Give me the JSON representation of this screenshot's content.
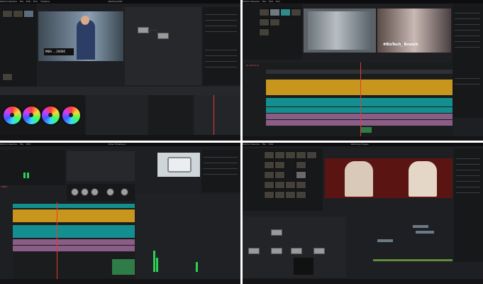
{
  "panels": {
    "color": {
      "menu": [
        "DaVinci Resolve",
        "File",
        "Edit",
        "Trim",
        "Timeline",
        "Clip",
        "Mark",
        "View",
        "Playback",
        "Fusion",
        "Color",
        "Fairlight",
        "Workspace",
        "Help"
      ],
      "window_title": "Wedding Edit",
      "overlay_text": "MBA ... 2000€"
    },
    "edit": {
      "menu": [
        "DaVinci Resolve",
        "File",
        "Edit",
        "Trim",
        "Timeline",
        "Clip",
        "Mark",
        "View",
        "Playback",
        "Fusion",
        "Color",
        "Fairlight",
        "Workspace",
        "Help"
      ],
      "timecode": "01:00:02:11",
      "overlay_text": "#BizTech_ Brunch"
    },
    "fairlight": {
      "menu": [
        "DaVinci Resolve",
        "File",
        "Edit",
        "Trim",
        "Timeline",
        "Clip",
        "Mark",
        "View",
        "Playback",
        "Fusion",
        "Color",
        "Fairlight",
        "Workspace",
        "Help"
      ],
      "window_title": "Video Timeline 1",
      "side_label": "TIMER"
    },
    "fusion": {
      "menu": [
        "DaVinci Resolve",
        "File",
        "Edit",
        "Trim",
        "Timeline",
        "Clip",
        "Mark",
        "View",
        "Playback",
        "Fusion",
        "Color",
        "Fairlight",
        "Workspace",
        "Help"
      ],
      "window_title": "Wedding Images"
    }
  }
}
